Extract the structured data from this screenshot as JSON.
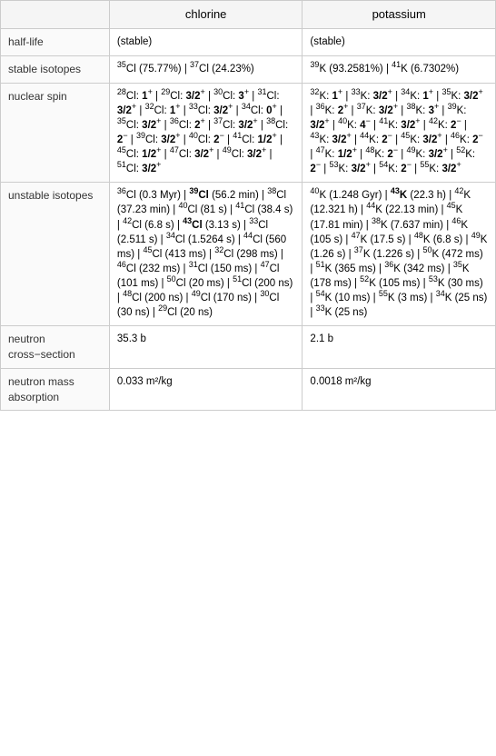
{
  "header": {
    "col1": "",
    "col2": "chlorine",
    "col3": "potassium"
  },
  "rows": [
    {
      "label": "half-life",
      "chlorine": "(stable)",
      "potassium": "(stable)"
    },
    {
      "label": "stable isotopes",
      "chlorine_html": "<sup>35</sup>Cl (75.77%) | <sup>37</sup>Cl (24.23%)",
      "potassium_html": "<sup>39</sup>K (93.2581%) | <sup>41</sup>K (6.7302%)"
    },
    {
      "label": "nuclear spin",
      "chlorine_html": "<sup>28</sup>Cl: <b>1</b><sup>+</sup> | <sup>29</sup>Cl: <b>3/2</b><sup>+</sup> | <sup>30</sup>Cl: <b>3</b><sup>+</sup> | <sup>31</sup>Cl: <b>3/2</b><sup>+</sup> | <sup>32</sup>Cl: <b>1</b><sup>+</sup> | <sup>33</sup>Cl: <b>3/2</b><sup>+</sup> | <sup>34</sup>Cl: <b>0</b><sup>+</sup> | <sup>35</sup>Cl: <b>3/2</b><sup>+</sup> | <sup>36</sup>Cl: <b>2</b><sup>+</sup> | <sup>37</sup>Cl: <b>3/2</b><sup>+</sup> | <sup>38</sup>Cl: <b>2</b><sup>−</sup> | <sup>39</sup>Cl: <b>3/2</b><sup>+</sup> | <sup>40</sup>Cl: <b>2</b><sup>−</sup> | <sup>41</sup>Cl: <b>1/2</b><sup>+</sup> | <sup>45</sup>Cl: <b>1/2</b><sup>+</sup> | <sup>47</sup>Cl: <b>3/2</b><sup>+</sup> | <sup>49</sup>Cl: <b>3/2</b><sup>+</sup> | <sup>51</sup>Cl: <b>3/2</b><sup>+</sup>",
      "potassium_html": "<sup>32</sup>K: <b>1</b><sup>+</sup> | <sup>33</sup>K: <b>3/2</b><sup>+</sup> | <sup>34</sup>K: <b>1</b><sup>+</sup> | <sup>35</sup>K: <b>3/2</b><sup>+</sup> | <sup>36</sup>K: <b>2</b><sup>+</sup> | <sup>37</sup>K: <b>3/2</b><sup>+</sup> | <sup>38</sup>K: <b>3</b><sup>+</sup> | <sup>39</sup>K: <b>3/2</b><sup>+</sup> | <sup>40</sup>K: <b>4</b><sup>−</sup> | <sup>41</sup>K: <b>3/2</b><sup>+</sup> | <sup>42</sup>K: <b>2</b><sup>−</sup> | <sup>43</sup>K: <b>3/2</b><sup>+</sup> | <sup>44</sup>K: <b>2</b><sup>−</sup> | <sup>45</sup>K: <b>3/2</b><sup>+</sup> | <sup>46</sup>K: <b>2</b><sup>−</sup> | <sup>47</sup>K: <b>1/2</b><sup>+</sup> | <sup>48</sup>K: <b>2</b><sup>−</sup> | <sup>49</sup>K: <b>3/2</b><sup>+</sup> | <sup>52</sup>K: <b>2</b><sup>−</sup> | <sup>53</sup>K: <b>3/2</b><sup>+</sup> | <sup>54</sup>K: <b>2</b><sup>−</sup> | <sup>55</sup>K: <b>3/2</b><sup>+</sup>"
    },
    {
      "label": "unstable isotopes",
      "chlorine_html": "<sup>36</sup>Cl (0.3 Myr) | <b><sup>39</sup>Cl</b> (56.2 min) | <sup>38</sup>Cl (37.23 min) | <sup>40</sup>Cl (81 s) | <sup>41</sup>Cl (38.4 s) | <sup>42</sup>Cl (6.8 s) | <b><sup>43</sup>Cl</b> (3.13 s) | <sup>33</sup>Cl (2.511 s) | <sup>34</sup>Cl (1.5264 s) | <sup>44</sup>Cl (560 ms) | <sup>45</sup>Cl (413 ms) | <sup>32</sup>Cl (298 ms) | <sup>46</sup>Cl (232 ms) | <sup>31</sup>Cl (150 ms) | <sup>47</sup>Cl (101 ms) | <sup>50</sup>Cl (20 ms) | <sup>51</sup>Cl (200 ns) | <sup>48</sup>Cl (200 ns) | <sup>49</sup>Cl (170 ns) | <sup>30</sup>Cl (30 ns) | <sup>29</sup>Cl (20 ns)",
      "potassium_html": "<sup>40</sup>K (1.248 Gyr) | <b><sup>43</sup>K</b> (22.3 h) | <sup>42</sup>K (12.321 h) | <sup>44</sup>K (22.13 min) | <sup>45</sup>K (17.81 min) | <sup>38</sup>K (7.637 min) | <sup>46</sup>K (105 s) | <sup>47</sup>K (17.5 s) | <sup>48</sup>K (6.8 s) | <sup>49</sup>K (1.26 s) | <sup>37</sup>K (1.226 s) | <sup>50</sup>K (472 ms) | <sup>51</sup>K (365 ms) | <sup>36</sup>K (342 ms) | <sup>35</sup>K (178 ms) | <sup>52</sup>K (105 ms) | <sup>53</sup>K (30 ms) | <sup>54</sup>K (10 ms) | <sup>55</sup>K (3 ms) | <sup>34</sup>K (25 ns) | <sup>33</sup>K (25 ns)"
    },
    {
      "label": "neutron cross−section",
      "chlorine": "35.3 b",
      "potassium": "2.1 b"
    },
    {
      "label": "neutron mass absorption",
      "chlorine": "0.033 m²/kg",
      "potassium": "0.0018 m²/kg"
    }
  ]
}
